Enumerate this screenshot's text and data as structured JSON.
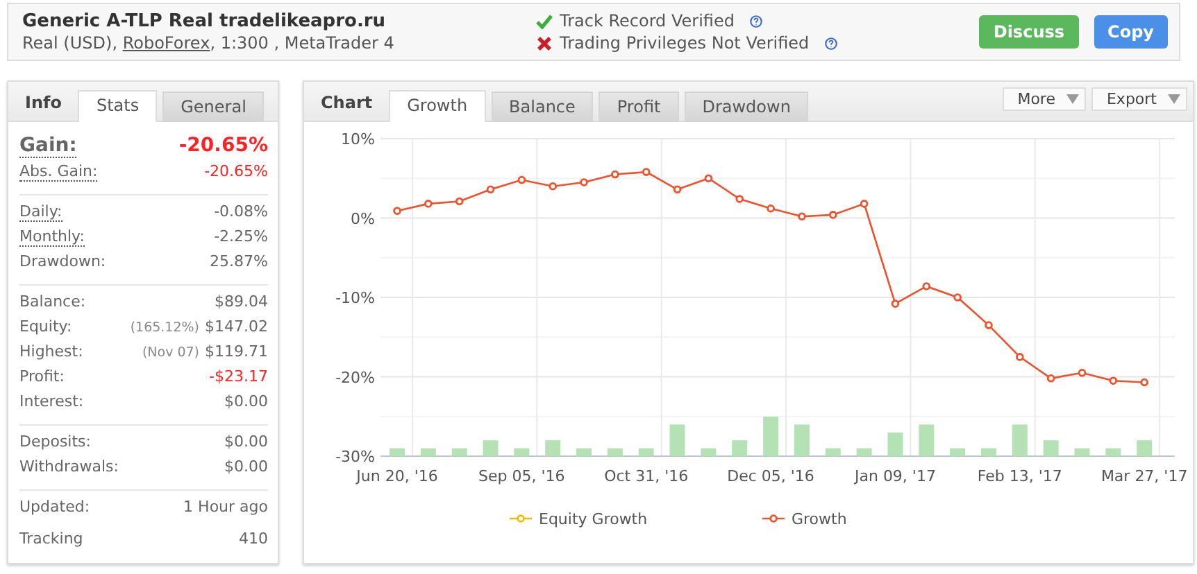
{
  "header": {
    "title": "Generic A-TLP Real tradelikeapro.ru",
    "account_prefix": "Real (USD), ",
    "broker": "RoboForex",
    "account_suffix": ", 1:300 , MetaTrader 4",
    "verifications": [
      {
        "label": "Track Record Verified",
        "verified": true
      },
      {
        "label": "Trading Privileges Not Verified",
        "verified": false
      }
    ],
    "buttons": [
      {
        "label": "Discuss",
        "kind": "discuss"
      },
      {
        "label": "Copy",
        "kind": "copy"
      }
    ]
  },
  "info": {
    "title": "Info",
    "tabs": [
      {
        "label": "Stats",
        "selected": true
      },
      {
        "label": "General",
        "selected": false
      }
    ],
    "sections": [
      [
        {
          "kind": "headline",
          "label": "Gain:",
          "value": "-20.65%",
          "negative": true,
          "dotted": true
        },
        {
          "kind": "row",
          "label": "Abs. Gain:",
          "value": "-20.65%",
          "negative": true,
          "dotted": true
        }
      ],
      [
        {
          "kind": "row",
          "label": "Daily:",
          "value": "-0.08%",
          "negative": false,
          "dotted": true
        },
        {
          "kind": "row",
          "label": "Monthly:",
          "value": "-2.25%",
          "negative": false,
          "dotted": true
        },
        {
          "kind": "row",
          "label": "Drawdown:",
          "value": "25.87%",
          "negative": false,
          "dotted": false
        }
      ],
      [
        {
          "kind": "row",
          "label": "Balance:",
          "value": "$89.04",
          "negative": false,
          "dotted": false
        },
        {
          "kind": "row",
          "label": "Equity:",
          "note": "(165.12%)",
          "value": "$147.02",
          "negative": false,
          "dotted": false
        },
        {
          "kind": "row",
          "label": "Highest:",
          "note": "(Nov 07)",
          "value": "$119.71",
          "negative": false,
          "dotted": false
        },
        {
          "kind": "row",
          "label": "Profit:",
          "value": "-$23.17",
          "negative": true,
          "dotted": false
        },
        {
          "kind": "row",
          "label": "Interest:",
          "value": "$0.00",
          "negative": false,
          "dotted": false
        }
      ],
      [
        {
          "kind": "row",
          "label": "Deposits:",
          "value": "$0.00",
          "negative": false,
          "dotted": false
        },
        {
          "kind": "row",
          "label": "Withdrawals:",
          "value": "$0.00",
          "negative": false,
          "dotted": false
        }
      ],
      [
        {
          "kind": "row",
          "label": "Updated:",
          "value": "1 Hour ago",
          "negative": false,
          "dotted": false
        },
        {
          "kind": "row",
          "label": "Tracking",
          "value": "410",
          "negative": false,
          "dotted": false
        }
      ]
    ]
  },
  "chart": {
    "title": "Chart",
    "tabs": [
      {
        "label": "Growth",
        "selected": true
      },
      {
        "label": "Balance",
        "selected": false
      },
      {
        "label": "Profit",
        "selected": false
      },
      {
        "label": "Drawdown",
        "selected": false
      }
    ],
    "menus": [
      "More",
      "Export"
    ],
    "other_legend": [
      {
        "label": "Equity Growth",
        "color": "#f5b800"
      }
    ],
    "chart_data": {
      "type": "line",
      "categories": [
        "Jun 20, '16",
        null,
        null,
        null,
        "Sep 05, '16",
        null,
        null,
        null,
        "Oct 31, '16",
        null,
        null,
        null,
        "Dec 05, '16",
        null,
        null,
        null,
        "Jan 09, '17",
        null,
        null,
        null,
        "Feb 13, '17",
        null,
        null,
        null,
        "Mar 27, '17"
      ],
      "series": [
        {
          "name": "Growth",
          "color": "#f0502a",
          "marker": "o",
          "values": [
            0.9,
            1.8,
            2.1,
            3.6,
            4.8,
            4.0,
            4.5,
            5.5,
            5.8,
            3.6,
            5.0,
            2.4,
            1.2,
            0.2,
            0.4,
            1.8,
            -10.8,
            -8.6,
            -10.0,
            -13.5,
            -17.5,
            -20.2,
            -19.5,
            -20.5,
            -20.7
          ]
        }
      ],
      "grid": true,
      "legend": "bottom",
      "ylim": [
        -30,
        10
      ],
      "yticks": [
        {
          "value": 10,
          "label": "10%"
        },
        {
          "value": 0,
          "label": "0%"
        },
        {
          "value": -10,
          "label": "-10%"
        },
        {
          "value": -20,
          "label": "-20%"
        },
        {
          "value": -30,
          "label": "-30%"
        }
      ]
    }
  }
}
